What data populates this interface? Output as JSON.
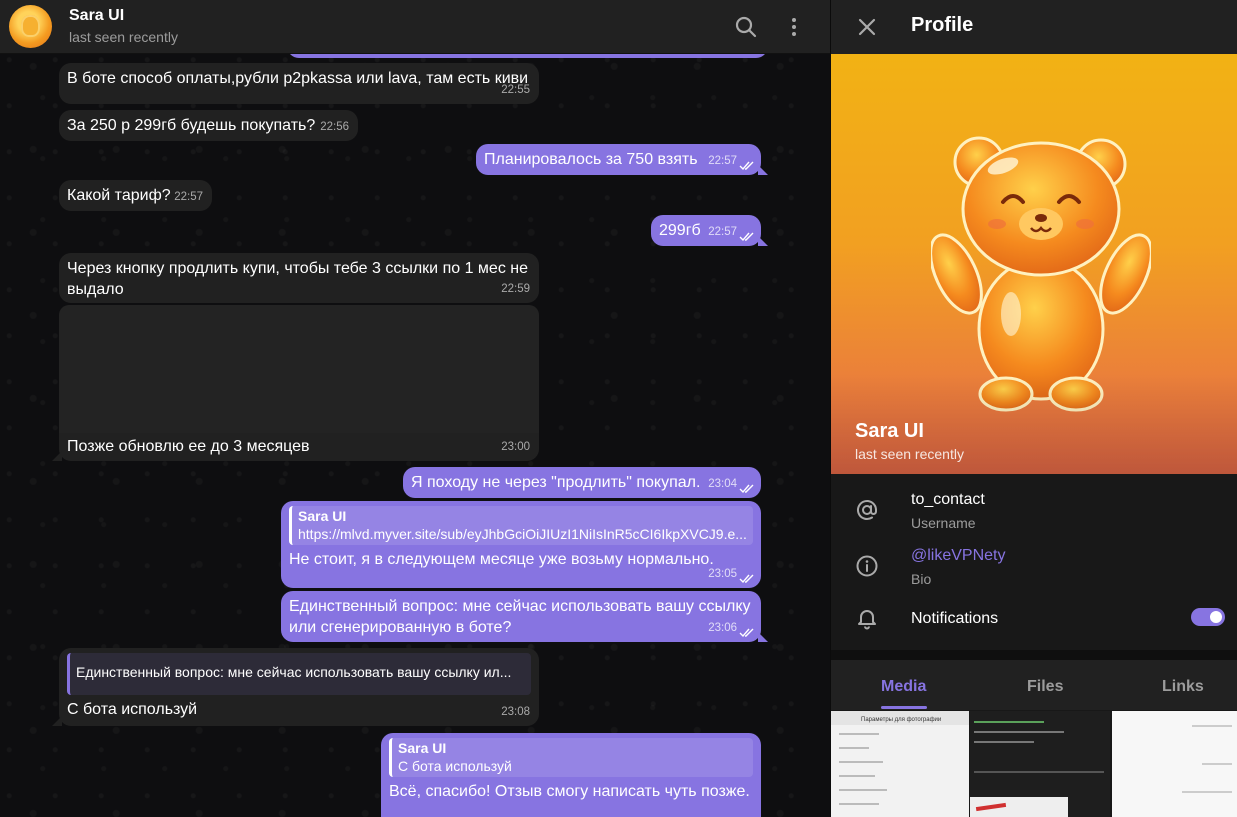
{
  "chat": {
    "title": "Sara UI",
    "status": "last seen recently",
    "messages": [
      {
        "text": "В боте способ оплаты,рубли p2pkassa или lava, там есть киви",
        "time": "22:55"
      },
      {
        "text": "За 250 р 299гб будешь покупать?",
        "time": "22:56"
      },
      {
        "text": "Планировалось за 750 взять",
        "time": "22:57"
      },
      {
        "text": "Какой тариф?",
        "time": "22:57"
      },
      {
        "text": "299гб",
        "time": "22:57"
      },
      {
        "text": "Через кнопку продлить купи, чтобы тебе 3 ссылки по 1 мес не выдало",
        "time": "22:59"
      },
      {
        "text": "Позже обновлю ее до 3 месяцев",
        "time": "23:00"
      },
      {
        "text": "Я походу не через \"продлить\" покупал.",
        "time": "23:04"
      },
      {
        "reply_name": "Sara UI",
        "reply_text": "https://mlvd.myver.site/sub/eyJhbGciOiJIUzI1NiIsInR5cCI6IkpXVCJ9.e...",
        "text": "Не стоит, я в следующем месяце уже возьму нормально.",
        "time": "23:05"
      },
      {
        "text": "Единственный вопрос: мне сейчас использовать вашу ссылку или сгенерированную в боте?",
        "time": "23:06"
      },
      {
        "reply_text": "Единственный вопрос: мне сейчас использовать вашу ссылку ил...",
        "text": "С бота используй",
        "time": "23:08"
      },
      {
        "reply_name": "Sara UI",
        "reply_text": "С бота используй",
        "text": "Всё, спасибо! Отзыв смогу написать чуть позже."
      }
    ]
  },
  "profile": {
    "header_title": "Profile",
    "name": "Sara UI",
    "status": "last seen recently",
    "username": "to_contact",
    "username_label": "Username",
    "bio": "@likeVPNety",
    "bio_label": "Bio",
    "notifications_label": "Notifications",
    "notifications_on": true,
    "tabs": [
      "Media",
      "Files",
      "Links"
    ],
    "active_tab": "Media",
    "thumb1_heading": "Параметры для фотографии"
  },
  "colors": {
    "accent": "#8774e1",
    "background": "#0f0f0f",
    "incoming_bubble": "#212121",
    "outgoing_bubble": "#8774e1"
  },
  "icons": [
    "search-icon",
    "more-vertical-icon",
    "close-icon",
    "at-sign-icon",
    "info-icon",
    "bell-icon",
    "double-check-icon"
  ]
}
